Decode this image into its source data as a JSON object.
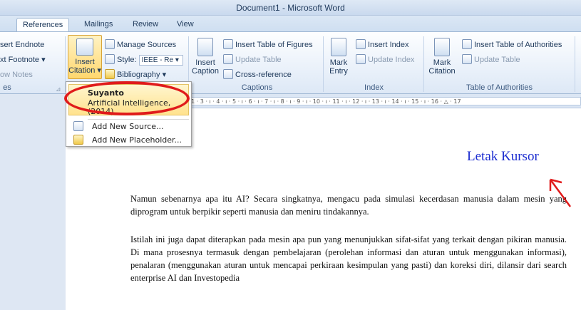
{
  "window": {
    "title": "Document1 - Microsoft Word"
  },
  "tabs": [
    {
      "label": "References",
      "active": true
    },
    {
      "label": "Mailings",
      "active": false
    },
    {
      "label": "Review",
      "active": false
    },
    {
      "label": "View",
      "active": false
    }
  ],
  "ribbon": {
    "footnotes": {
      "insert_endnote": "sert Endnote",
      "next_footnote": "xt Footnote ▾",
      "show_notes": "ow Notes",
      "group_label": "es"
    },
    "citations": {
      "insert_citation_line1": "Insert",
      "insert_citation_line2": "Citation ▾",
      "manage_sources": "Manage Sources",
      "style_label": "Style:",
      "style_value": "IEEE - Re ▾",
      "bibliography": "Bibliography ▾"
    },
    "captions": {
      "insert_caption_line1": "Insert",
      "insert_caption_line2": "Caption",
      "insert_table_of_figures": "Insert Table of Figures",
      "update_table": "Update Table",
      "cross_reference": "Cross-reference",
      "group_label": "Captions"
    },
    "index": {
      "mark_entry_line1": "Mark",
      "mark_entry_line2": "Entry",
      "insert_index": "Insert Index",
      "update_index": "Update Index",
      "group_label": "Index"
    },
    "authorities": {
      "mark_citation_line1": "Mark",
      "mark_citation_line2": "Citation",
      "insert_table_of_authorities": "Insert Table of Authorities",
      "update_table": "Update Table",
      "group_label": "Table of Authorities"
    }
  },
  "ruler": {
    "text": "· 1 · 3 · ı · 4 · ı · 5 · ı · 6 · ı · 7 · ı · 8 · ı · 9 · ı · 10 · ı · 11 · ı · 12 · ı · 13 · ı · 14 · ı · 15 · ı · 16 · △ · 17"
  },
  "citation_dropdown": {
    "source_author": "Suyanto",
    "source_title": "Artificial Intelligence,",
    "source_year": "(2014)",
    "add_new_source": "Add New Source...",
    "add_new_placeholder": "Add New Placeholder..."
  },
  "annotation": {
    "label": "Letak Kursor",
    "color": "#1a2bd0"
  },
  "document": {
    "paragraph1": "Namun sebenarnya apa itu AI? Secara singkatnya, mengacu pada simulasi kecerdasan manusia dalam mesin yang diprogram untuk berpikir seperti manusia dan meniru tindakannya.",
    "paragraph2": "Istilah ini juga dapat diterapkan pada mesin apa pun yang menunjukkan sifat-sifat yang terkait dengan pikiran manusia. Di mana prosesnya termasuk dengan pembelajaran (perolehan informasi dan aturan untuk menggunakan informasi), penalaran (menggunakan aturan untuk mencapai perkiraan kesimpulan yang pasti) dan koreksi diri, dilansir dari search enterprise AI dan Investopedia"
  },
  "colors": {
    "highlight_ellipse": "#e01b1b",
    "ribbon_bg": "#eaf1fa"
  }
}
